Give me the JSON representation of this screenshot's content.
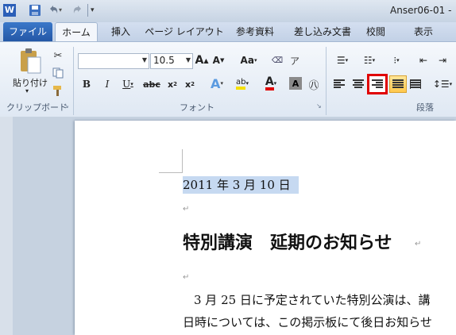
{
  "window": {
    "title": "Anser06-01 -"
  },
  "tabs": [
    "ファイル",
    "ホーム",
    "挿入",
    "ページ レイアウト",
    "参考資料",
    "差し込み文書",
    "校閲",
    "表示"
  ],
  "ribbon": {
    "clipboard": {
      "paste_label": "貼り付け",
      "group_label": "クリップボード"
    },
    "font": {
      "font_size": "10.5",
      "group_label": "フォント"
    },
    "paragraph": {
      "group_label": "段落"
    }
  },
  "document": {
    "date_line": "2011 年 3 月 10 日",
    "heading": "特別講演　延期のお知らせ",
    "body_line1": "3 月 25 日に予定されていた特別公演は、講",
    "body_line2": "日時については、この掲示板にて後日お知らせ"
  },
  "colors": {
    "highlight_red": "#e00000",
    "selection": "#c6d9f1",
    "file_tab": "#2b63b5"
  }
}
